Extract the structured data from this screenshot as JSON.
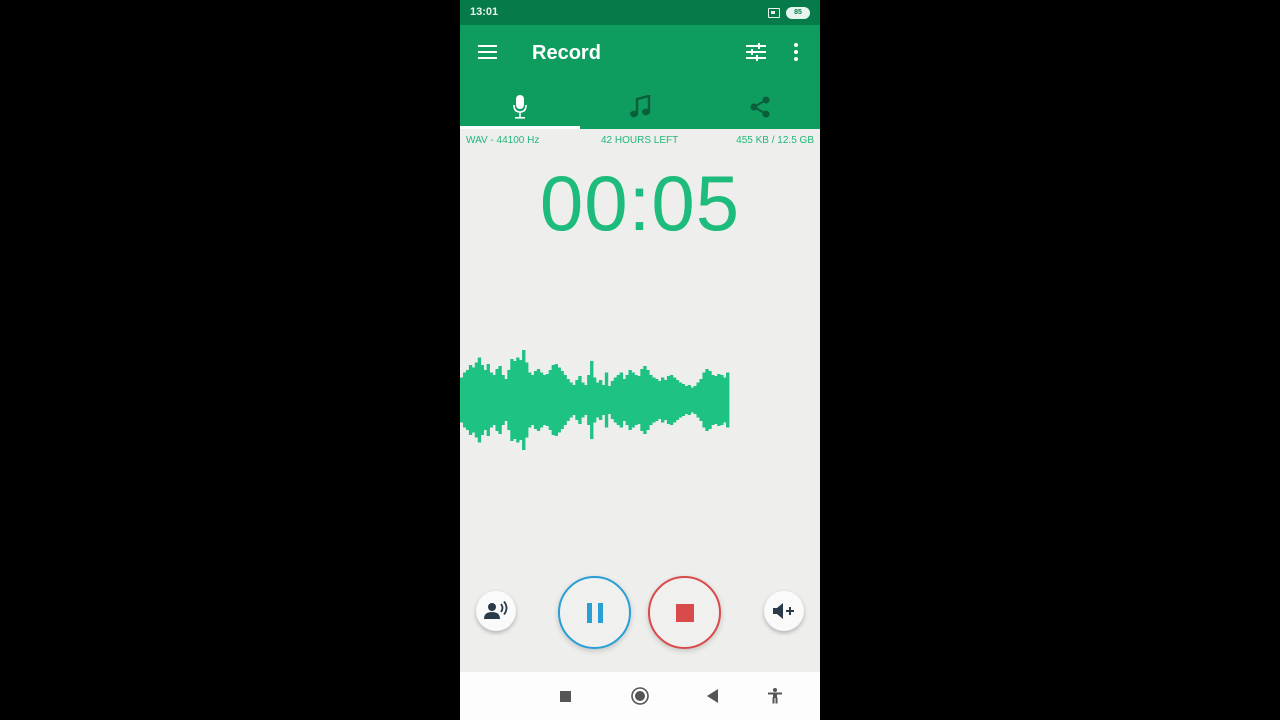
{
  "status_bar": {
    "time": "13:01",
    "battery_level": "85",
    "icons": [
      "sim-icon",
      "battery-icon"
    ]
  },
  "app_bar": {
    "title": "Record",
    "icons": [
      "menu-icon",
      "tune-icon",
      "more-vert-icon"
    ]
  },
  "tabs": [
    {
      "name": "record",
      "icon": "microphone-icon",
      "active": true
    },
    {
      "name": "music",
      "icon": "music-note-icon",
      "active": false
    },
    {
      "name": "share",
      "icon": "share-icon",
      "active": false
    }
  ],
  "info_bar": {
    "format": "WAV - 44100 Hz",
    "time_left": "42 HOURS LEFT",
    "storage": "455 KB / 12.5 GB"
  },
  "recording": {
    "elapsed": "00:05",
    "waveform_amplitudes": [
      0.45,
      0.55,
      0.6,
      0.7,
      0.65,
      0.75,
      0.85,
      0.7,
      0.6,
      0.72,
      0.55,
      0.5,
      0.62,
      0.68,
      0.5,
      0.42,
      0.6,
      0.82,
      0.78,
      0.85,
      0.8,
      1.0,
      0.75,
      0.55,
      0.5,
      0.58,
      0.62,
      0.55,
      0.5,
      0.52,
      0.6,
      0.7,
      0.72,
      0.65,
      0.58,
      0.5,
      0.42,
      0.35,
      0.3,
      0.4,
      0.48,
      0.35,
      0.3,
      0.5,
      0.78,
      0.45,
      0.35,
      0.4,
      0.3,
      0.55,
      0.28,
      0.38,
      0.45,
      0.5,
      0.55,
      0.42,
      0.5,
      0.6,
      0.55,
      0.5,
      0.48,
      0.62,
      0.68,
      0.6,
      0.5,
      0.45,
      0.42,
      0.38,
      0.45,
      0.4,
      0.48,
      0.5,
      0.45,
      0.4,
      0.35,
      0.32,
      0.28,
      0.3,
      0.25,
      0.28,
      0.35,
      0.42,
      0.55,
      0.62,
      0.58,
      0.5,
      0.48,
      0.52,
      0.5,
      0.45,
      0.55
    ]
  },
  "controls": {
    "left": {
      "icon": "voice-person-icon",
      "label": "voice"
    },
    "pause": {
      "icon": "pause-icon",
      "color": "#2a9fd6"
    },
    "stop": {
      "icon": "stop-icon",
      "color": "#d94a4a"
    },
    "right": {
      "icon": "volume-plus-icon",
      "label": "gain"
    }
  },
  "colors": {
    "status_bar": "#077a4a",
    "app_bar": "#0e9c5f",
    "accent": "#1dbb7c",
    "waveform": "#1ec283"
  },
  "nav_bar": [
    "recents-square-icon",
    "home-circle-icon",
    "back-triangle-icon",
    "accessibility-icon"
  ]
}
